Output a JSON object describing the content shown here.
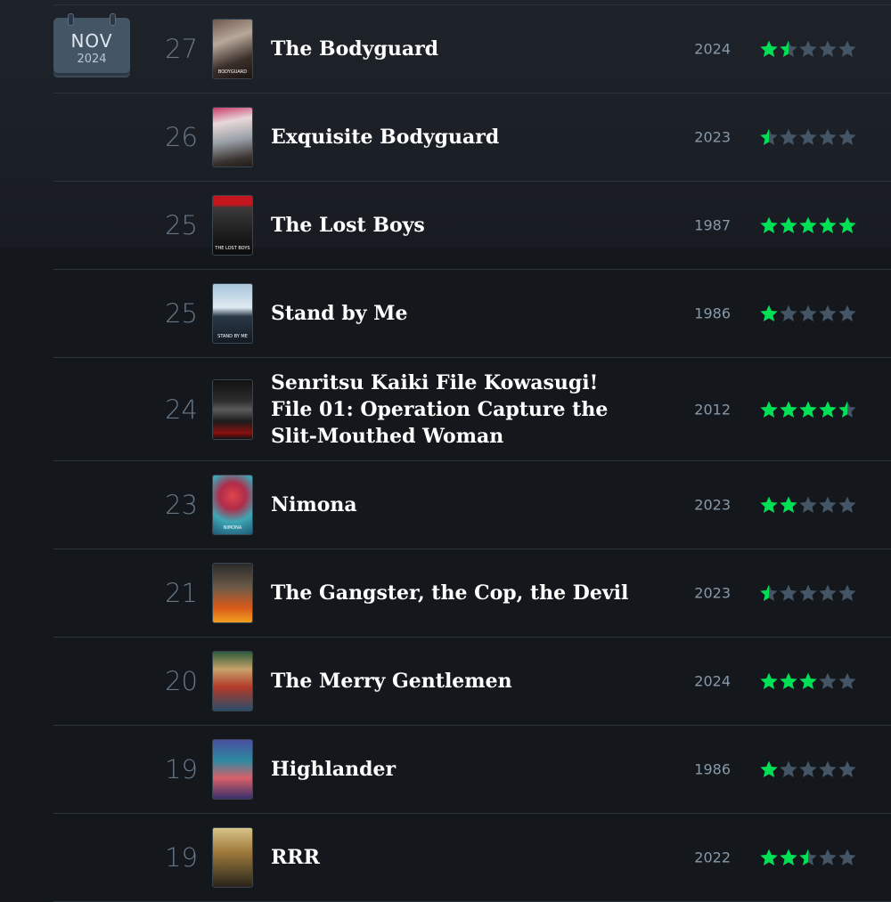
{
  "calendar": {
    "month": "NOV",
    "year": "2024"
  },
  "colors": {
    "star_filled": "#00e054",
    "star_empty": "#445566",
    "title": "#ffffff",
    "year": "#8899aa",
    "day": "#667788"
  },
  "entries": [
    {
      "day": "27",
      "title": "The Bodyguard",
      "year": "2024",
      "rating": 1.5,
      "poster_caption": "BODYGUARD"
    },
    {
      "day": "26",
      "title": "Exquisite Bodyguard",
      "year": "2023",
      "rating": 0.5,
      "poster_caption": ""
    },
    {
      "day": "25",
      "title": "The Lost Boys",
      "year": "1987",
      "rating": 5,
      "poster_caption": "THE LOST BOYS"
    },
    {
      "day": "25",
      "title": "Stand by Me",
      "year": "1986",
      "rating": 1,
      "poster_caption": "STAND BY ME"
    },
    {
      "day": "24",
      "title": "Senritsu Kaiki File Kowasugi! File 01: Operation Capture the Slit-Mouthed Woman",
      "year": "2012",
      "rating": 4.5,
      "poster_caption": ""
    },
    {
      "day": "23",
      "title": "Nimona",
      "year": "2023",
      "rating": 2,
      "poster_caption": "NIMONA"
    },
    {
      "day": "21",
      "title": "The Gangster, the Cop, the Devil",
      "year": "2023",
      "rating": 0.5,
      "poster_caption": ""
    },
    {
      "day": "20",
      "title": "The Merry Gentlemen",
      "year": "2024",
      "rating": 3,
      "poster_caption": ""
    },
    {
      "day": "19",
      "title": "Highlander",
      "year": "1986",
      "rating": 1,
      "poster_caption": ""
    },
    {
      "day": "19",
      "title": "RRR",
      "year": "2022",
      "rating": 2.5,
      "poster_caption": ""
    }
  ]
}
